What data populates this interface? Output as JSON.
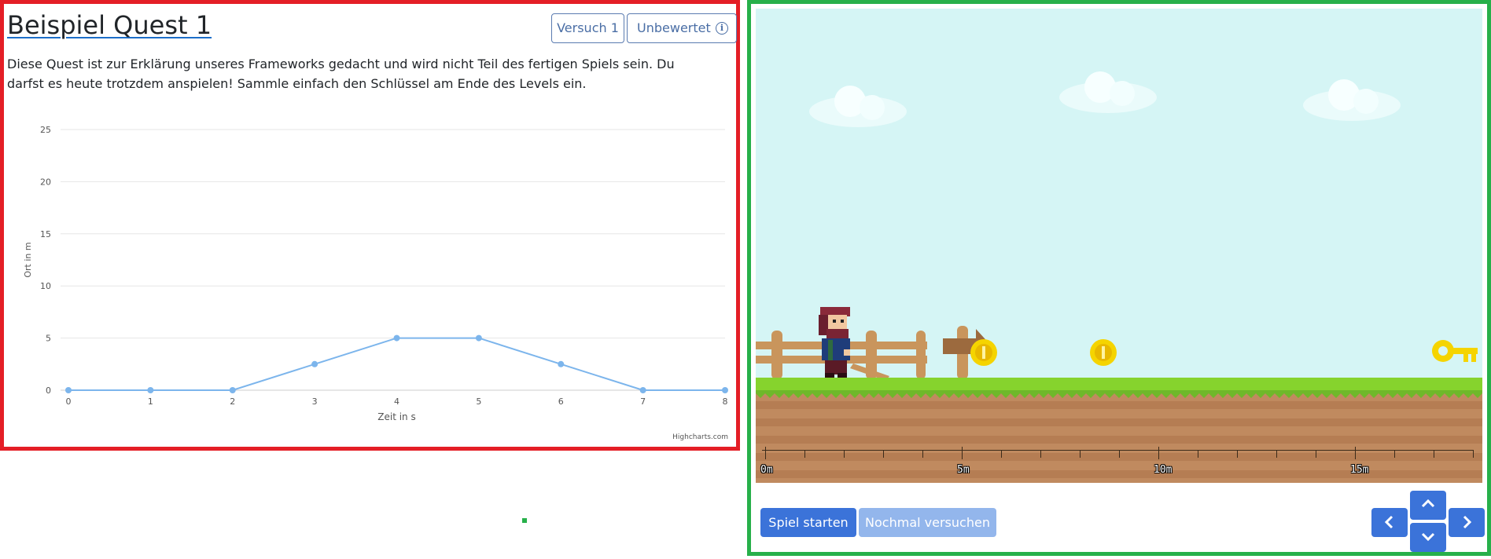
{
  "quest": {
    "title": "Beispiel Quest 1",
    "attempt_label": "Versuch 1",
    "grade_label": "Unbewertet",
    "description": "Diese Quest ist zur Erklärung unseres Frameworks gedacht und wird nicht Teil des fertigen Spiels sein. Du darfst es heute trotzdem anspielen! Sammle einfach den Schlüssel am Ende des Levels ein."
  },
  "chart_data": {
    "type": "line",
    "title": "",
    "xlabel": "Zeit in s",
    "ylabel": "Ort in m",
    "x": [
      0,
      1,
      2,
      3,
      4,
      5,
      6,
      7,
      8
    ],
    "series": [
      {
        "values": [
          0,
          0,
          0,
          2.5,
          5,
          5,
          2.5,
          0,
          0
        ]
      }
    ],
    "xlim": [
      0,
      8
    ],
    "ylim": [
      0,
      25
    ],
    "yticks": [
      0,
      5,
      10,
      15,
      20,
      25
    ],
    "xticks": [
      0,
      1,
      2,
      3,
      4,
      5,
      6,
      7,
      8
    ],
    "grid": true,
    "legend": "none",
    "credits": "Highcharts.com",
    "line_color": "#7cb5ec"
  },
  "game": {
    "ruler_labels": [
      "0m",
      "5m",
      "10m",
      "15m"
    ],
    "start_label": "Spiel starten",
    "retry_label": "Nochmal versuchen",
    "controls": [
      "chevron-left-icon",
      "chevron-up-icon",
      "chevron-down-icon",
      "chevron-right-icon"
    ],
    "colors": {
      "sky": "#d5f5f5",
      "grass": "#86d32d",
      "dirt": "#c08a5f",
      "coin": "#f5d400",
      "key": "#f5d400",
      "button": "#3b73d9"
    }
  }
}
